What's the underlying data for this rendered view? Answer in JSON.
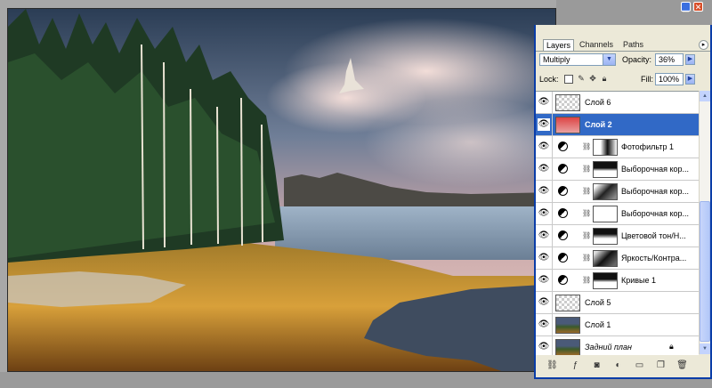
{
  "panel": {
    "tabs": [
      {
        "label": "Layers",
        "active": true
      },
      {
        "label": "Channels",
        "active": false
      },
      {
        "label": "Paths",
        "active": false
      }
    ],
    "blend_mode": "Multiply",
    "opacity_label": "Opacity:",
    "opacity_value": "36%",
    "lock_label": "Lock:",
    "fill_label": "Fill:",
    "fill_value": "100%"
  },
  "layers": [
    {
      "name": "Слой 6",
      "type": "pixel",
      "thumb": "checker",
      "selected": false
    },
    {
      "name": "Слой 2",
      "type": "pixel",
      "thumb": "red",
      "selected": true
    },
    {
      "name": "Фотофильтр 1",
      "type": "adjustment",
      "mask": "mostly-white",
      "selected": false
    },
    {
      "name": "Выборочная кор...",
      "type": "adjustment",
      "mask": "dark-top",
      "selected": false
    },
    {
      "name": "Выборочная кор...",
      "type": "adjustment",
      "mask": "dark-gradient",
      "selected": false
    },
    {
      "name": "Выборочная кор...",
      "type": "adjustment",
      "mask": "white",
      "selected": false
    },
    {
      "name": "Цветовой тон/Н...",
      "type": "adjustment",
      "mask": "dark-top",
      "selected": false
    },
    {
      "name": "Яркость/Контра...",
      "type": "adjustment",
      "mask": "dark-gradient",
      "selected": false
    },
    {
      "name": "Кривые 1",
      "type": "adjustment",
      "mask": "dark-top",
      "selected": false
    },
    {
      "name": "Слой 5",
      "type": "pixel",
      "thumb": "checker",
      "selected": false
    },
    {
      "name": "Слой 1",
      "type": "pixel",
      "thumb": "photo",
      "selected": false
    },
    {
      "name": "Задний план",
      "type": "background",
      "thumb": "photo",
      "selected": false,
      "locked": true
    }
  ],
  "colors": {
    "selection": "#3169c6",
    "titlebar": "#0a4ad0",
    "panel_bg": "#ece9d8"
  },
  "icons": {
    "visibility": "eye-icon",
    "adjustment": "adjustment-layer-icon",
    "link": "chain-link-icon",
    "lock": "lock-icon"
  }
}
